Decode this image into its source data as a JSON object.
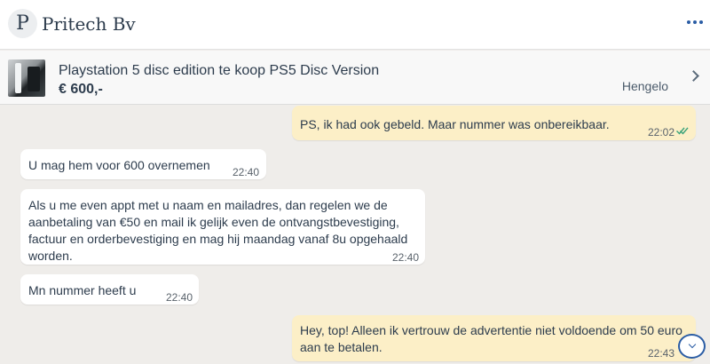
{
  "header": {
    "avatar_letter": "P",
    "contact_name": "Pritech Bv",
    "more_icon": "more-dots-icon"
  },
  "listing": {
    "title": "Playstation 5 disc edition te koop PS5 Disc Version",
    "price": "€ 600,-",
    "location": "Hengelo"
  },
  "messages": [
    {
      "direction": "out",
      "text": "PS, ik had ook gebeld. Maar nummer was onbereikbaar.",
      "time": "22:02",
      "status": "read"
    },
    {
      "direction": "in",
      "text": "U mag hem voor 600 overnemen",
      "time": "22:40"
    },
    {
      "direction": "in",
      "text": "Als u me even appt met u naam en mailadres, dan regelen we de aanbetaling van €50 en mail ik gelijk even de ontvangstbevestiging, factuur en orderbevestiging en mag hij maandag vanaf 8u opgehaald worden.",
      "time": "22:40"
    },
    {
      "direction": "in",
      "text": "Mn nummer heeft u",
      "time": "22:40"
    },
    {
      "direction": "out",
      "text": "Hey, top! Alleen ik vertrouw de advertentie niet voldoende om 50 euro aan te betalen.",
      "time": "22:43",
      "status": "read"
    }
  ],
  "colors": {
    "chat_background": "#efedea",
    "incoming_bubble": "#ffffff",
    "outgoing_bubble": "#fcefc7",
    "accent": "#2b5da5",
    "read_check": "#3aa37a"
  }
}
